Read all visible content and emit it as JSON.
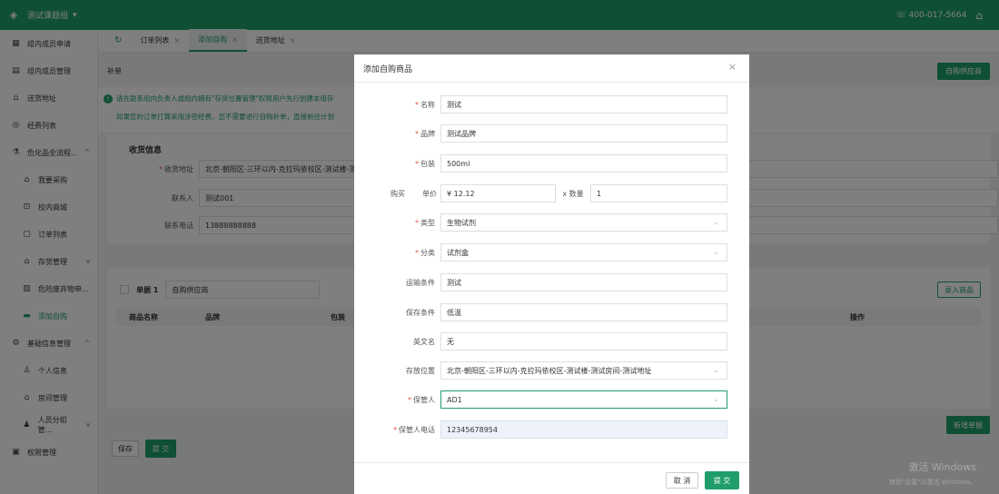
{
  "topbar": {
    "team": "测试课题组",
    "team_caret": "▾",
    "phone": "400-017-5664",
    "phone_icon": "☏"
  },
  "sidebar": {
    "items": [
      {
        "label": "组内成员申请",
        "icon": "grid"
      },
      {
        "label": "组内成员管理",
        "icon": "list"
      },
      {
        "label": "送货地址",
        "icon": "home"
      },
      {
        "label": "经费列表",
        "icon": "coin"
      },
      {
        "label": "危化品全流程...",
        "icon": "flask",
        "arrow": "^"
      },
      {
        "label": "我要采购",
        "icon": "house"
      },
      {
        "label": "校内商城",
        "icon": "cart"
      },
      {
        "label": "订单列表",
        "icon": "doc"
      },
      {
        "label": "存货管理",
        "icon": "home",
        "arrow": "v"
      },
      {
        "label": "危险废弃物申...",
        "icon": "trash"
      },
      {
        "label": "添加自购",
        "icon": "cart",
        "active": true
      },
      {
        "label": "基础信息管理",
        "icon": "gear",
        "arrow": "^"
      },
      {
        "label": "个人信息",
        "icon": "user"
      },
      {
        "label": "房间管理",
        "icon": "house"
      },
      {
        "label": "人员分组管...",
        "icon": "users",
        "arrow": "v"
      },
      {
        "label": "权限管理",
        "icon": "key"
      }
    ]
  },
  "tabs": [
    {
      "label": "订单列表",
      "close": "×"
    },
    {
      "label": "添加自购",
      "close": "×",
      "active": true
    },
    {
      "label": "送货地址",
      "close": "×"
    }
  ],
  "main": {
    "crumb": "补单",
    "supplier_button": "自购供应商",
    "notice_line1": "请先联系组内负责人或组内拥有\"存货位置管理\"权限用户先行创建本组存",
    "notice_line2": "如果您的订单打算采用涉密经费，您不需要进行自购补单，直接前往计划",
    "receive_title": "收货信息",
    "address_label": "收货地址",
    "address_value": "北京-朝阳区-三环以内-克拉玛依校区-测试楼-测",
    "contact_label": "联系人",
    "contact_value": "测试001",
    "phone_label": "联系电话",
    "phone_value": "13888888888",
    "order_label": "单据 1",
    "order_supplier": "自购供应商",
    "import_button": "录入商品",
    "table_headers": [
      "商品名称",
      "品牌",
      "包装",
      "操作"
    ],
    "new_order_button": "新增单据",
    "save_button": "保存",
    "submit_button": "提 交"
  },
  "dialog": {
    "title": "添加自购商品",
    "close": "×",
    "name_label": "名称",
    "name_value": "测试",
    "brand_label": "品牌",
    "brand_value": "测试品牌",
    "pack_label": "包装",
    "pack_value": "500ml",
    "buy_label": "购买",
    "unit_label": "单价",
    "unit_value": "¥ 12.12",
    "qty_label": "x 数量",
    "qty_value": "1",
    "type_label": "类型",
    "type_value": "生物试剂",
    "category_label": "分类",
    "category_value": "试剂盒",
    "transport_label": "运输条件",
    "transport_value": "测试",
    "storage_label": "保存条件",
    "storage_value": "低温",
    "en_label": "英文名",
    "en_value": "无",
    "location_label": "存放位置",
    "location_value": "北京-朝阳区-三环以内-克拉玛依校区-测试楼-测试房间-测试地址",
    "keeper_label": "保管人",
    "keeper_value": "AD1",
    "keeper_phone_label": "保管人电话",
    "keeper_phone_value": "12345678954",
    "cancel_button": "取 消",
    "submit_button": "提 交"
  },
  "watermark": {
    "line1": "激活 Windows",
    "line2": "转到\"设置\"以激活 Windows。"
  },
  "colors": {
    "accent": "#1f9e6b",
    "required": "#e5534b"
  }
}
